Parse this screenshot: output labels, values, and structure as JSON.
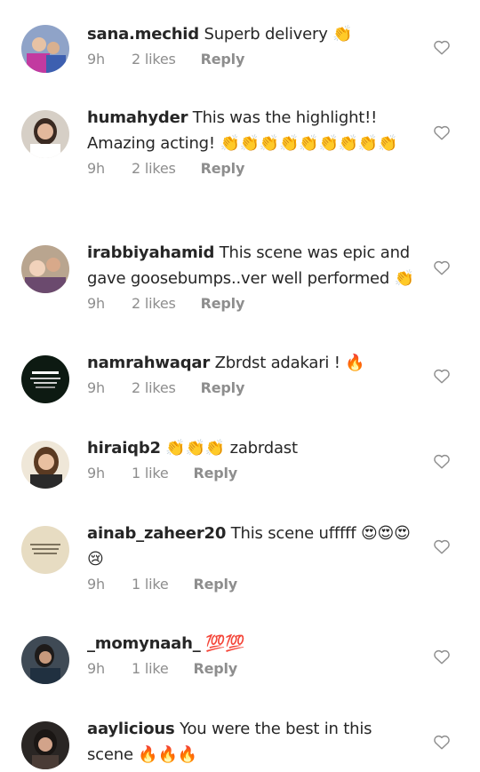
{
  "comments": [
    {
      "username": "sana.mechid",
      "text": "Superb delivery 👏",
      "time": "9h",
      "likes": "2 likes",
      "reply": "Reply"
    },
    {
      "username": "humahyder",
      "text": "This was the highlight!! Amazing acting! 👏👏👏👏👏👏👏👏👏",
      "time": "9h",
      "likes": "2 likes",
      "reply": "Reply"
    },
    {
      "username": "irabbiyahamid",
      "text": "This scene was epic and gave goosebumps..ver well performed 👏",
      "time": "9h",
      "likes": "2 likes",
      "reply": "Reply"
    },
    {
      "username": "namrahwaqar",
      "text": "Zbrdst adakari ! 🔥",
      "time": "9h",
      "likes": "2 likes",
      "reply": "Reply"
    },
    {
      "username": "hiraiqb2",
      "text": "👏👏👏 zabrdast",
      "time": "9h",
      "likes": "1 like",
      "reply": "Reply"
    },
    {
      "username": "ainab_zaheer20",
      "text": "This scene ufffff 😍😍😍😢",
      "time": "9h",
      "likes": "1 like",
      "reply": "Reply"
    },
    {
      "username": "_momynaah_",
      "text": "💯💯",
      "time": "9h",
      "likes": "1 like",
      "reply": "Reply"
    },
    {
      "username": "aaylicious",
      "text": "You were the best in this scene 🔥🔥🔥",
      "time": "",
      "likes": "",
      "reply": ""
    }
  ],
  "icons": {
    "like": "heart-outline-icon"
  },
  "colors": {
    "text": "#262626",
    "meta": "#8e8e8e",
    "emoji": "#f4b400"
  }
}
